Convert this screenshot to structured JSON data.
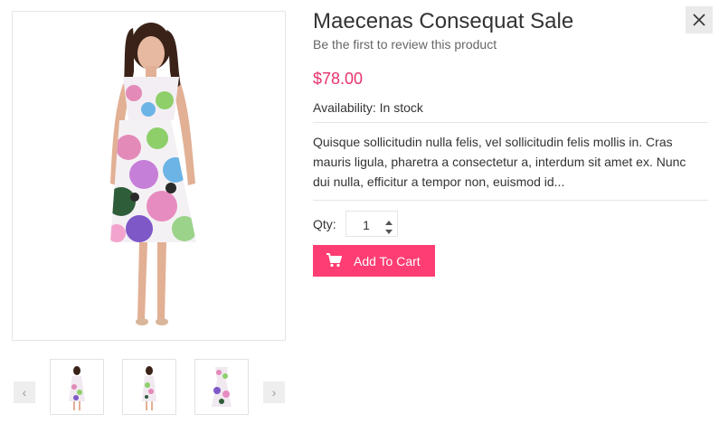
{
  "product": {
    "title": "Maecenas Consequat Sale",
    "review_link": "Be the first to review this product",
    "price": "$78.00",
    "availability": "Availability: In stock",
    "description": "Quisque sollicitudin nulla felis, vel sollicitudin felis mollis in. Cras mauris ligula, pharetra a consectetur a, interdum sit amet ex. Nunc dui nulla, efficitur a tempor non, euismod id..."
  },
  "quantity": {
    "label": "Qty:",
    "value": "1"
  },
  "actions": {
    "add_to_cart": "Add To Cart"
  },
  "colors": {
    "accent": "#fd3d73",
    "price": "#e8336c"
  },
  "icons": {
    "close": "close-icon",
    "cart": "cart-icon",
    "prev": "chevron-left-icon",
    "next": "chevron-right-icon"
  }
}
